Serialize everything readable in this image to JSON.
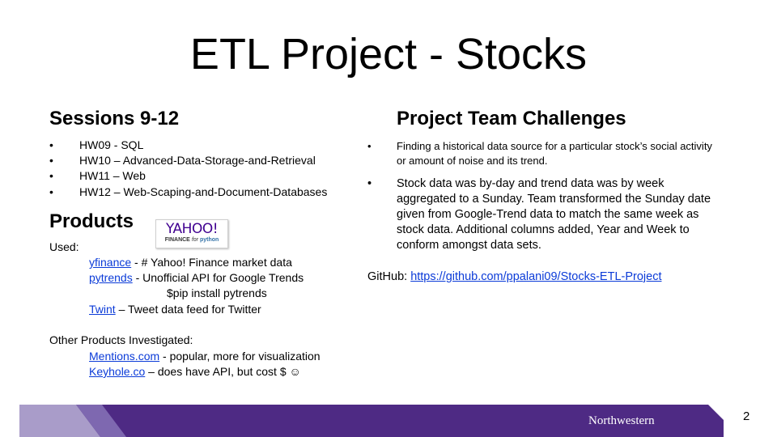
{
  "slide": {
    "title": "ETL Project - Stocks",
    "page_number": "2"
  },
  "sessions": {
    "heading": "Sessions 9-12",
    "items": [
      "HW09 - SQL",
      "HW10 – Advanced-Data-Storage-and-Retrieval",
      "HW11 – Web",
      "HW12 – Web-Scaping-and-Document-Databases"
    ]
  },
  "products": {
    "heading": "Products",
    "used_label": "Used:",
    "used": [
      {
        "link": "yfinance",
        "desc": " - # Yahoo! Finance market data"
      },
      {
        "link": "pytrends",
        "desc": " - Unofficial API for Google Trends"
      },
      {
        "link": "Twint",
        "desc": " – Tweet data feed for Twitter"
      }
    ],
    "pip_command": "$pip install pytrends",
    "other_label": "Other Products Investigated:",
    "other": [
      {
        "link": "Mentions.com",
        "desc": " - popular, more for visualization"
      },
      {
        "link": "Keyhole.co",
        "desc": " – does have API, but cost $ ☺"
      }
    ],
    "logo": {
      "word": "YAHOO!",
      "sub_prefix": "FINANCE",
      "sub_for": "for",
      "sub_python": "python"
    }
  },
  "challenges": {
    "heading": "Project Team Challenges",
    "items": [
      "Finding a historical data source for a particular stock’s social activity or amount of noise and its trend.",
      "Stock data was by-day and trend data was by week aggregated to a Sunday.    Team transformed the Sunday date given from Google-Trend data to match the same week as stock data.  Additional columns added, Year and Week to conform amongst data sets."
    ],
    "github_label": "GitHub: ",
    "github_url": "https://github.com/ppalani09/Stocks-ETL-Project"
  },
  "footer": {
    "brand": "Northwestern",
    "colors": {
      "purple": "#4e2a84",
      "light_purple": "#a99cc9",
      "mid_purple": "#7e68b0"
    }
  }
}
